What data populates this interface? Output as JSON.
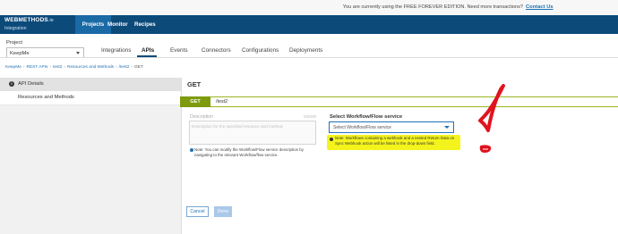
{
  "banner": {
    "text": "You are currently using the FREE FOREVER EDITION. Need more transactions?",
    "link": "Contact Us"
  },
  "brand": {
    "name": "WEBMETHODS",
    "suffix": ".io",
    "sub": "Integration"
  },
  "topnav": [
    "Projects",
    "Monitor",
    "Recipes"
  ],
  "project": {
    "label": "Project",
    "value": "KeepMe"
  },
  "tabs": [
    "Integrations",
    "APIs",
    "Events",
    "Connectors",
    "Configurations",
    "Deployments"
  ],
  "breadcrumb": [
    "KeepMe",
    "REST APIs",
    "test2",
    "Resources and Methods",
    "/test2",
    "GET"
  ],
  "sidebar": {
    "items": [
      "API Details",
      "Resources and Methods"
    ]
  },
  "main": {
    "title": "GET",
    "method": "GET",
    "path": "/test2",
    "description_label": "Description",
    "description_count": "0/2000",
    "description_placeholder": "Description for the specified resource and method",
    "note_left": "Note: You can modify the Workflow/Flow service description by navigating to the relevant Workflow/flow service.",
    "workflow_label": "Select Workflow/Flow service",
    "workflow_placeholder": "Select Workflow/Flow service",
    "note_right": "Note: Workflows containing a webhook and a nested Return Data on Sync Webhook action will be listed in the drop-down field.",
    "cancel": "Cancel",
    "done": "Done"
  },
  "colors": {
    "navbar": "#0c4a7a",
    "method_badge": "#7e9b0f",
    "highlight": "#f4f41c",
    "annotation": "#e0141e"
  },
  "icons": [
    "info-icon",
    "chevron-down-icon"
  ]
}
